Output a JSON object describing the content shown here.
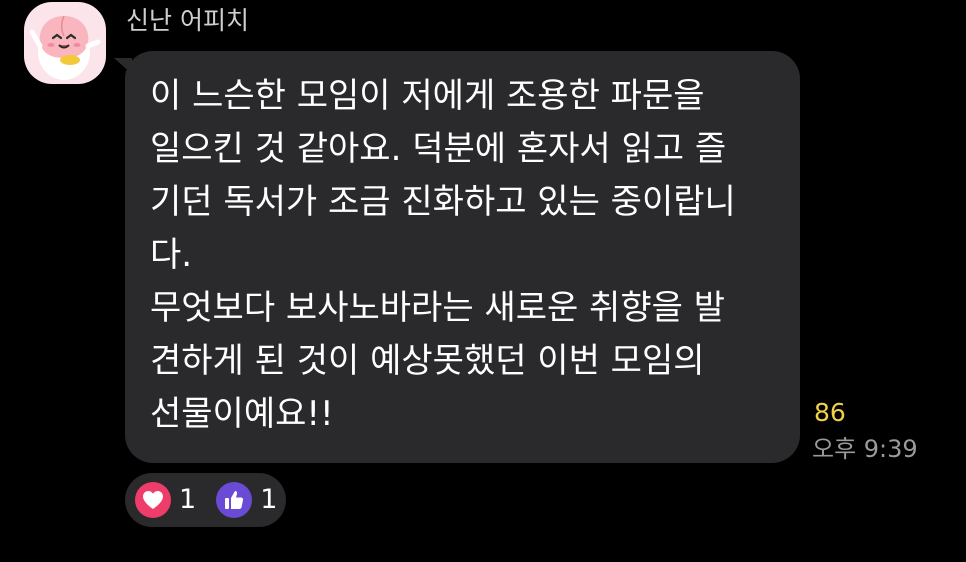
{
  "sender": {
    "name": "신난 어피치",
    "avatar_icon": "apeach-avatar"
  },
  "message": {
    "lines": [
      "이 느슨한 모임이 저에게 조용한 파문을",
      "일으킨 것 같아요. 덕분에 혼자서 읽고 즐",
      "기던 독서가 조금 진화하고 있는 중이랍니",
      "다.",
      "무엇보다 보사노바라는 새로운 취향을 발",
      "견하게 된 것이 예상못했던 이번 모임의",
      "선물이예요!!"
    ],
    "unread_count": "86",
    "time": "오후 9:39"
  },
  "reactions": [
    {
      "icon": "heart-icon",
      "count": "1",
      "color": "#ef3d6b"
    },
    {
      "icon": "thumbs-up-icon",
      "count": "1",
      "color": "#6a4bd6"
    }
  ],
  "colors": {
    "background": "#000000",
    "bubble": "#2a2a2c",
    "unread": "#f1cf48",
    "timestamp": "#9a9a9a",
    "avatar_bg": "#fbe4ea"
  }
}
